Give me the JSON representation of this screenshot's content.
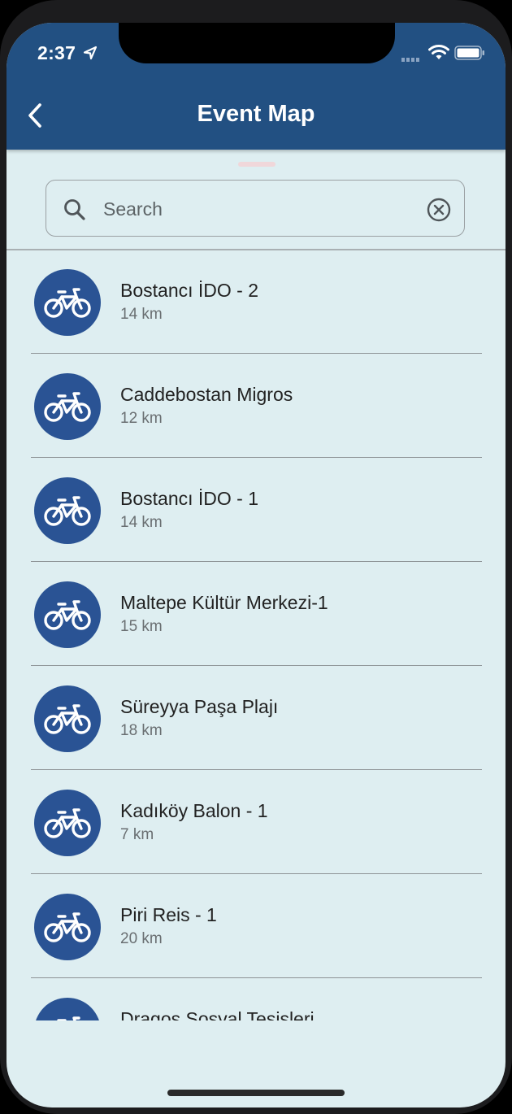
{
  "status_bar": {
    "time": "2:37"
  },
  "header": {
    "title": "Event Map"
  },
  "search": {
    "placeholder": "Search",
    "value": ""
  },
  "stations": [
    {
      "name": "Bostancı İDO - 2",
      "distance": "14 km"
    },
    {
      "name": "Caddebostan Migros",
      "distance": "12 km"
    },
    {
      "name": "Bostancı İDO - 1",
      "distance": "14 km"
    },
    {
      "name": "Maltepe Kültür Merkezi-1",
      "distance": "15 km"
    },
    {
      "name": "Süreyya Paşa Plajı",
      "distance": "18 km"
    },
    {
      "name": "Kadıköy Balon - 1",
      "distance": "7 km"
    },
    {
      "name": "Piri Reis - 1",
      "distance": "20 km"
    },
    {
      "name": "Dragos Sosyal Tesisleri",
      "distance": ""
    }
  ],
  "icons": {
    "list_item": "bicycle-icon",
    "search": "search-icon",
    "clear": "clear-circle-icon",
    "back": "chevron-left-icon"
  },
  "colors": {
    "header": "#225082",
    "avatar": "#2a5394",
    "background": "#deeef1"
  }
}
